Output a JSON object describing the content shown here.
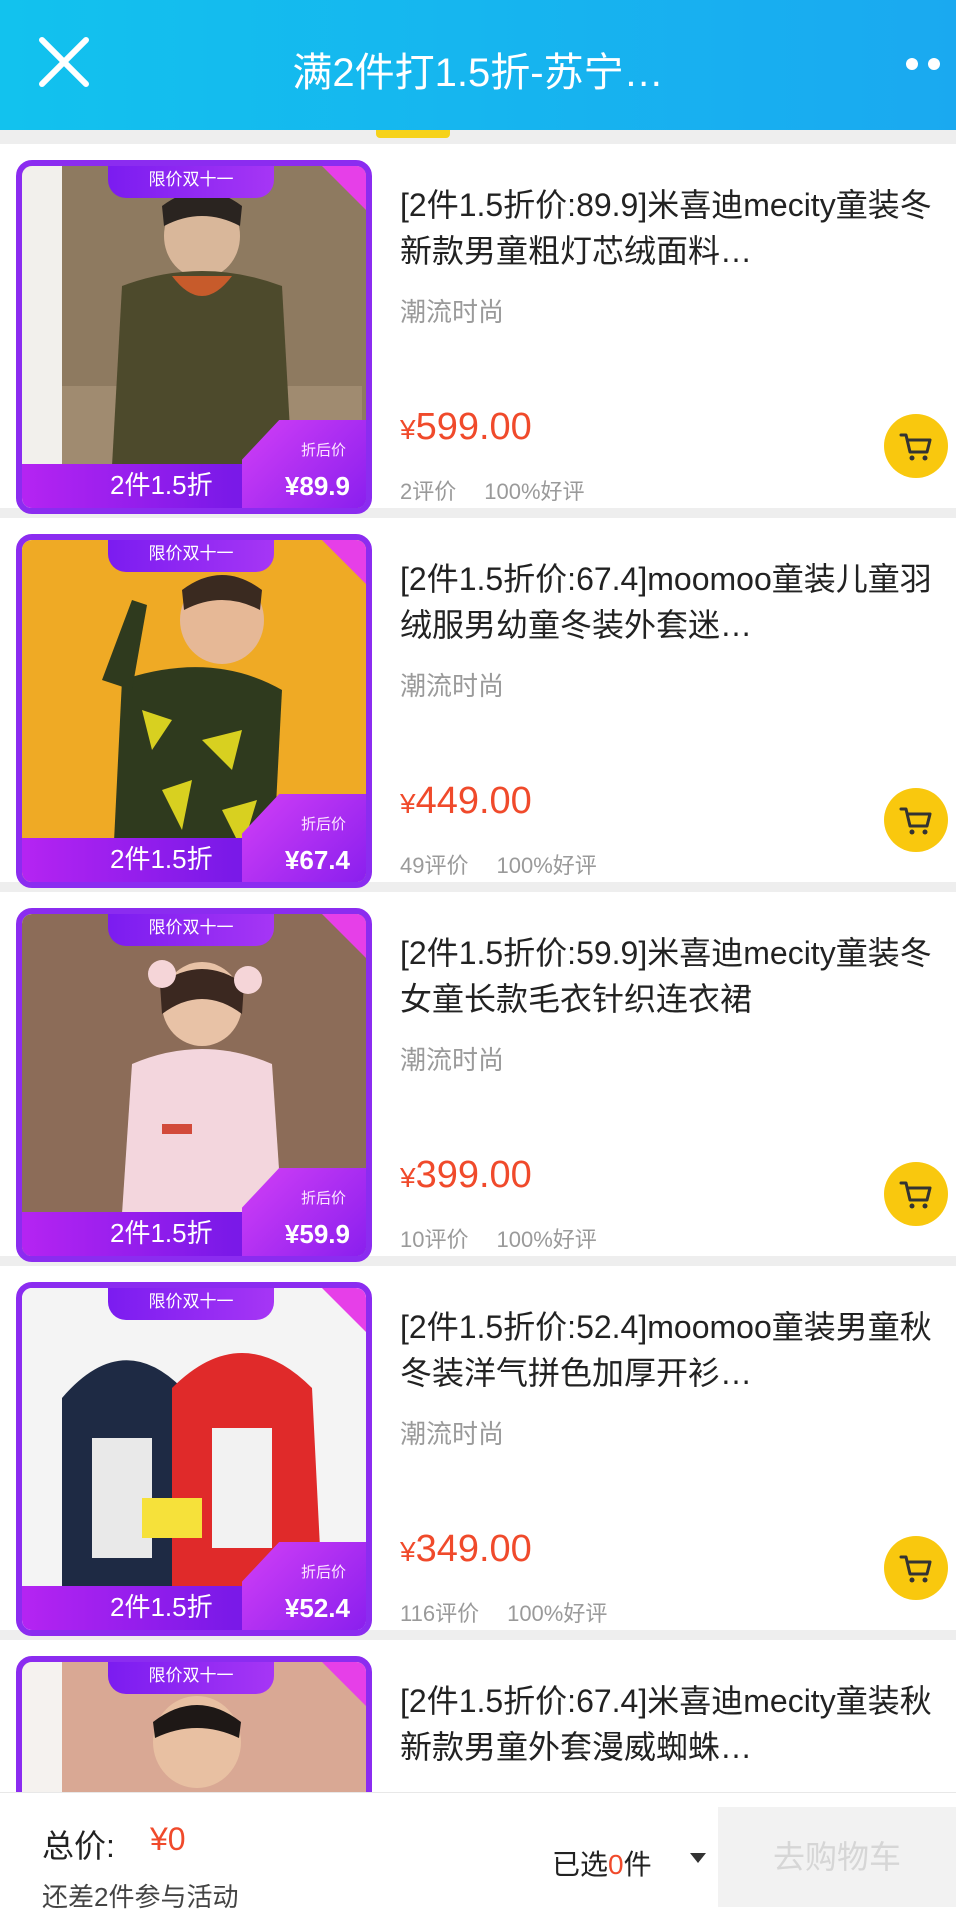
{
  "header": {
    "title": "满2件打1.5折-苏宁…",
    "colors": {
      "bg": "#12c2ee",
      "indicator": "#f6d21a"
    }
  },
  "items": [
    {
      "promo_tab": "限价双十一",
      "promo_bar_text": "2件1.5折",
      "badge_label": "折后价",
      "badge_price": "¥89.9",
      "title": "[2件1.5折价:89.9]米喜迪mecity童装冬新款男童粗灯芯绒面料…",
      "category": "潮流时尚",
      "price_symbol": "¥",
      "price": "599.00",
      "reviews": "2评价",
      "positive": "100%好评"
    },
    {
      "promo_tab": "限价双十一",
      "promo_bar_text": "2件1.5折",
      "badge_label": "折后价",
      "badge_price": "¥67.4",
      "title": "[2件1.5折价:67.4]moomoo童装儿童羽绒服男幼童冬装外套迷…",
      "category": "潮流时尚",
      "price_symbol": "¥",
      "price": "449.00",
      "reviews": "49评价",
      "positive": "100%好评"
    },
    {
      "promo_tab": "限价双十一",
      "promo_bar_text": "2件1.5折",
      "badge_label": "折后价",
      "badge_price": "¥59.9",
      "title": "[2件1.5折价:59.9]米喜迪mecity童装冬女童长款毛衣针织连衣裙",
      "category": "潮流时尚",
      "price_symbol": "¥",
      "price": "399.00",
      "reviews": "10评价",
      "positive": "100%好评"
    },
    {
      "promo_tab": "限价双十一",
      "promo_bar_text": "2件1.5折",
      "badge_label": "折后价",
      "badge_price": "¥52.4",
      "title": "[2件1.5折价:52.4]moomoo童装男童秋冬装洋气拼色加厚开衫…",
      "category": "潮流时尚",
      "price_symbol": "¥",
      "price": "349.00",
      "reviews": "116评价",
      "positive": "100%好评"
    },
    {
      "promo_tab": "限价双十一",
      "title": "[2件1.5折价:67.4]米喜迪mecity童装秋新款男童外套漫威蜘蛛…"
    }
  ],
  "bottom": {
    "total_label": "总价:",
    "total_value": "¥0",
    "remain": "还差2件参与活动",
    "selected_prefix": "已选",
    "selected_count": "0",
    "selected_suffix": "件",
    "checkout": "去购物车"
  }
}
